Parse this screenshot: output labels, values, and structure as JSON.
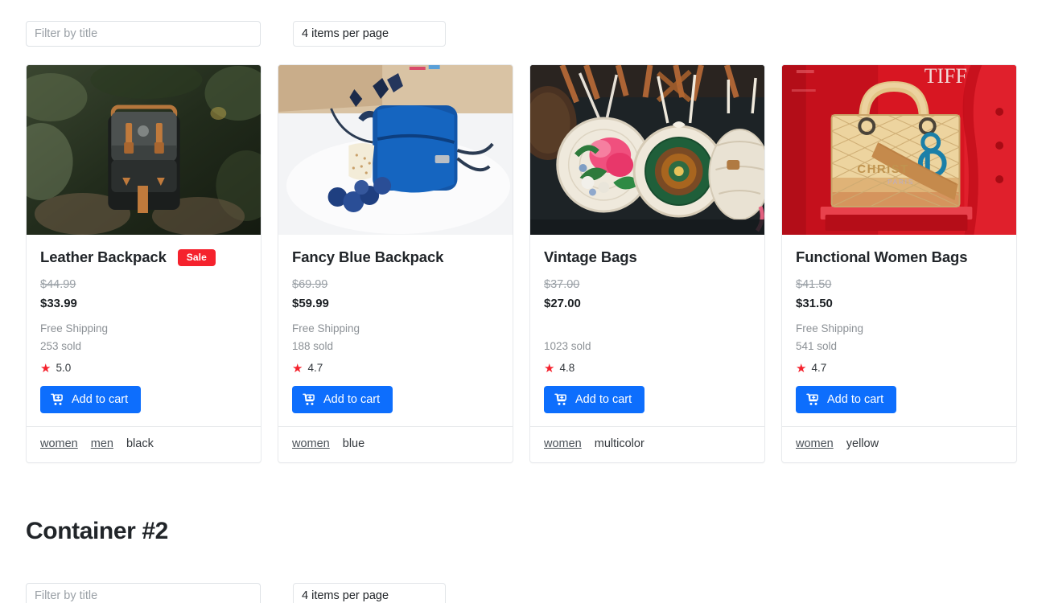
{
  "sections": [
    {
      "heading": null,
      "filter": {
        "placeholder": "Filter by title",
        "value": ""
      },
      "per_page": {
        "value": "4 items per page"
      },
      "products": [
        {
          "title": "Leather Backpack",
          "badge": "Sale",
          "price_old": "$44.99",
          "price_new": "$33.99",
          "shipping": "Free Shipping",
          "sold": "253 sold",
          "rating": "5.0",
          "add_label": "Add to cart",
          "tags": [
            {
              "text": "women",
              "link": true
            },
            {
              "text": "men",
              "link": true
            },
            {
              "text": "black",
              "link": false
            }
          ],
          "image": "leather-backpack-in-forest"
        },
        {
          "title": "Fancy Blue Backpack",
          "badge": null,
          "price_old": "$69.99",
          "price_new": "$59.99",
          "shipping": "Free Shipping",
          "sold": "188 sold",
          "rating": "4.7",
          "add_label": "Add to cart",
          "tags": [
            {
              "text": "women",
              "link": true
            },
            {
              "text": "blue",
              "link": false
            }
          ],
          "image": "blue-backpack-on-table"
        },
        {
          "title": "Vintage Bags",
          "badge": null,
          "price_old": "$37.00",
          "price_new": "$27.00",
          "shipping": "",
          "sold": "1023 sold",
          "rating": "4.8",
          "add_label": "Add to cart",
          "tags": [
            {
              "text": "women",
              "link": true
            },
            {
              "text": "multicolor",
              "link": false
            }
          ],
          "image": "round-rattan-bags"
        },
        {
          "title": "Functional Women Bags",
          "badge": null,
          "price_old": "$41.50",
          "price_new": "$31.50",
          "shipping": "Free Shipping",
          "sold": "541 sold",
          "rating": "4.7",
          "add_label": "Add to cart",
          "tags": [
            {
              "text": "women",
              "link": true
            },
            {
              "text": "yellow",
              "link": false
            }
          ],
          "image": "woven-handbag-red-background"
        }
      ]
    },
    {
      "heading": "Container #2",
      "filter": {
        "placeholder": "Filter by title",
        "value": ""
      },
      "per_page": {
        "value": "4 items per page"
      },
      "products": []
    }
  ],
  "icons": {
    "star": "star-icon",
    "cart": "cart-plus-icon"
  },
  "colors": {
    "accent": "#0d6efd",
    "sale": "#f5222d",
    "star": "#f5222d",
    "muted": "#8c9196",
    "border": "#e8eaed"
  }
}
